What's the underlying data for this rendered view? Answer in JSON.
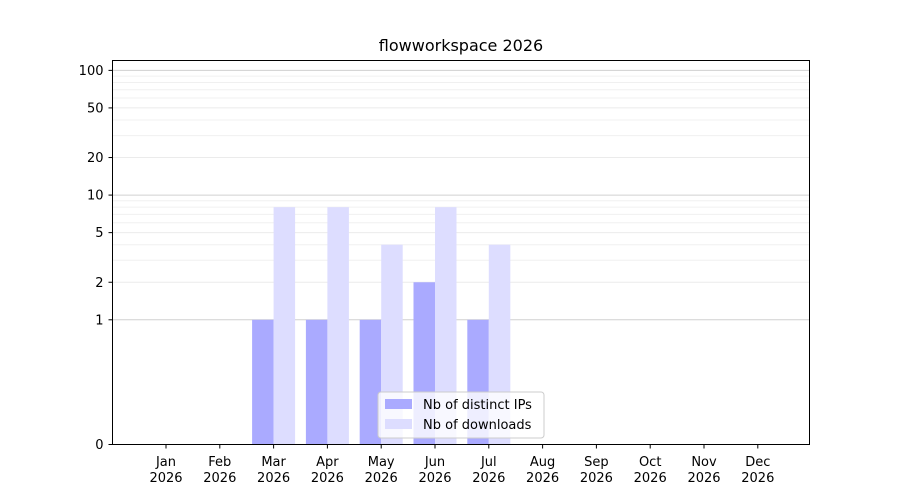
{
  "chart_data": {
    "type": "bar",
    "title": "flowworkspace 2026",
    "xlabel": "",
    "ylabel": "",
    "yscale": "symlog",
    "ylim": [
      0,
      120
    ],
    "yticks": [
      0,
      1,
      2,
      5,
      10,
      20,
      50,
      100
    ],
    "ytick_labels": [
      "0",
      "1",
      "2",
      "5",
      "10",
      "20",
      "50",
      "100"
    ],
    "categories": [
      "Jan\n2026",
      "Feb\n2026",
      "Mar\n2026",
      "Apr\n2026",
      "May\n2026",
      "Jun\n2026",
      "Jul\n2026",
      "Aug\n2026",
      "Sep\n2026",
      "Oct\n2026",
      "Nov\n2026",
      "Dec\n2026"
    ],
    "category_lines": [
      [
        "Jan",
        "2026"
      ],
      [
        "Feb",
        "2026"
      ],
      [
        "Mar",
        "2026"
      ],
      [
        "Apr",
        "2026"
      ],
      [
        "May",
        "2026"
      ],
      [
        "Jun",
        "2026"
      ],
      [
        "Jul",
        "2026"
      ],
      [
        "Aug",
        "2026"
      ],
      [
        "Sep",
        "2026"
      ],
      [
        "Oct",
        "2026"
      ],
      [
        "Nov",
        "2026"
      ],
      [
        "Dec",
        "2026"
      ]
    ],
    "series": [
      {
        "name": "Nb of distinct IPs",
        "values": [
          0,
          0,
          1,
          1,
          1,
          2,
          1,
          0,
          0,
          0,
          0,
          0
        ],
        "color": "#aaaaff"
      },
      {
        "name": "Nb of downloads",
        "values": [
          0,
          0,
          8,
          8,
          4,
          8,
          4,
          0,
          0,
          0,
          0,
          0
        ],
        "color": "#ddddff"
      }
    ],
    "grid": true,
    "legend_position": "lower center"
  }
}
